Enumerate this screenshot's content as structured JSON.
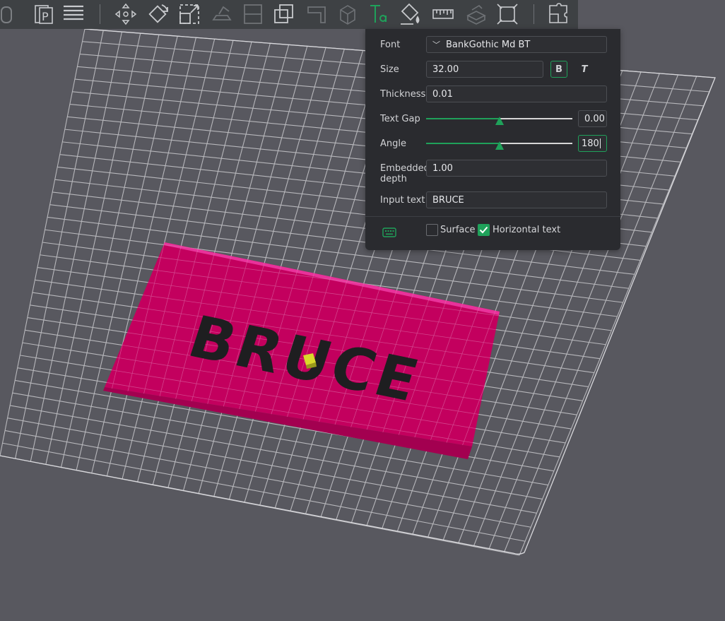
{
  "toolbar": {
    "tools": [
      {
        "name": "cylinder-icon"
      },
      {
        "name": "plate-icon"
      },
      {
        "name": "arrange-icon"
      },
      {
        "name": "move-icon"
      },
      {
        "name": "rotate-icon"
      },
      {
        "name": "scale-icon"
      },
      {
        "name": "lay-on-face-icon"
      },
      {
        "name": "cut-icon"
      },
      {
        "name": "boolean-icon"
      },
      {
        "name": "support-paint-icon"
      },
      {
        "name": "cube-icon"
      },
      {
        "name": "text-tool-icon"
      },
      {
        "name": "color-paint-icon"
      },
      {
        "name": "measure-icon"
      },
      {
        "name": "assembly-icon"
      },
      {
        "name": "split-icon"
      },
      {
        "name": "puzzle-icon"
      }
    ]
  },
  "panel": {
    "font_label": "Font",
    "font_value": "BankGothic Md BT",
    "font_chevron": "﹀",
    "size_label": "Size",
    "size_value": "32.00",
    "bold_label": "B",
    "italic_label": "T",
    "thickness_label": "Thickness",
    "thickness_value": "0.01",
    "text_gap_label": "Text Gap",
    "text_gap_value": "0.00",
    "text_gap_level": 0.5,
    "angle_label": "Angle",
    "angle_value": "180",
    "angle_level": 0.5,
    "embedded_label_1": "Embedded",
    "embedded_label_2": "depth",
    "embedded_value": "1.00",
    "input_text_label": "Input text",
    "input_text_value": "BRUCE",
    "surface_label": "Surface",
    "surface_checked": false,
    "horizontal_label": "Horizontal text",
    "horizontal_checked": true
  },
  "model": {
    "text": "BRUCE",
    "plate_color": "#c3005e",
    "text_color": "#1e1e20"
  },
  "colors": {
    "accent": "#1fa15a",
    "background": "#58585f",
    "toolbar": "#3e4144",
    "panel": "#2a2b2f"
  }
}
